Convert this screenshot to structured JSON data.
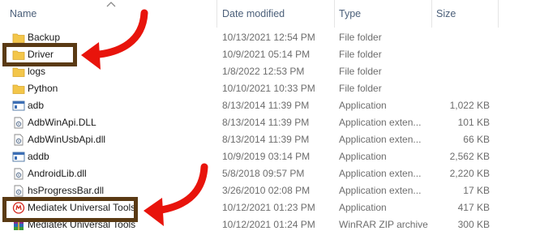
{
  "columns": {
    "name": "Name",
    "date": "Date modified",
    "type": "Type",
    "size": "Size"
  },
  "files": [
    {
      "name": "Backup",
      "date": "10/13/2021 12:54 PM",
      "type": "File folder",
      "size": "",
      "icon": "folder-icon"
    },
    {
      "name": "Driver",
      "date": "10/9/2021 05:14 PM",
      "type": "File folder",
      "size": "",
      "icon": "folder-icon"
    },
    {
      "name": "logs",
      "date": "1/8/2022 12:53 PM",
      "type": "File folder",
      "size": "",
      "icon": "folder-icon"
    },
    {
      "name": "Python",
      "date": "10/10/2021 10:33 PM",
      "type": "File folder",
      "size": "",
      "icon": "folder-icon"
    },
    {
      "name": "adb",
      "date": "8/13/2014 11:39 PM",
      "type": "Application",
      "size": "1,022 KB",
      "icon": "application-icon"
    },
    {
      "name": "AdbWinApi.DLL",
      "date": "8/13/2014 11:39 PM",
      "type": "Application exten...",
      "size": "101 KB",
      "icon": "dll-file-icon"
    },
    {
      "name": "AdbWinUsbApi.dll",
      "date": "8/13/2014 11:39 PM",
      "type": "Application exten...",
      "size": "66 KB",
      "icon": "dll-file-icon"
    },
    {
      "name": "addb",
      "date": "10/9/2019 03:14 PM",
      "type": "Application",
      "size": "2,562 KB",
      "icon": "application-icon"
    },
    {
      "name": "AndroidLib.dll",
      "date": "5/8/2018 09:57 PM",
      "type": "Application exten...",
      "size": "2,220 KB",
      "icon": "dll-file-icon"
    },
    {
      "name": "hsProgressBar.dll",
      "date": "3/26/2010 02:08 PM",
      "type": "Application exten...",
      "size": "17 KB",
      "icon": "dll-file-icon"
    },
    {
      "name": "Mediatek Universal Tools",
      "date": "10/12/2021 01:23 PM",
      "type": "Application",
      "size": "417 KB",
      "icon": "mediatek-app-icon"
    },
    {
      "name": "Mediatek Universal Tools",
      "date": "10/12/2021 01:24 PM",
      "type": "WinRAR ZIP archive",
      "size": "300 KB",
      "icon": "winrar-archive-icon"
    }
  ],
  "colors": {
    "annotation_arrow": "#e8140c",
    "annotation_box": "#5a3a14",
    "folder": "#f3c64a",
    "header_text": "#4c607a"
  },
  "annotations": [
    {
      "type": "box-with-arrow",
      "target": "Driver",
      "icon": "red-curved-arrow-icon"
    },
    {
      "type": "box-with-arrow",
      "target": "Mediatek Universal Tools",
      "icon": "red-curved-arrow-icon"
    }
  ]
}
